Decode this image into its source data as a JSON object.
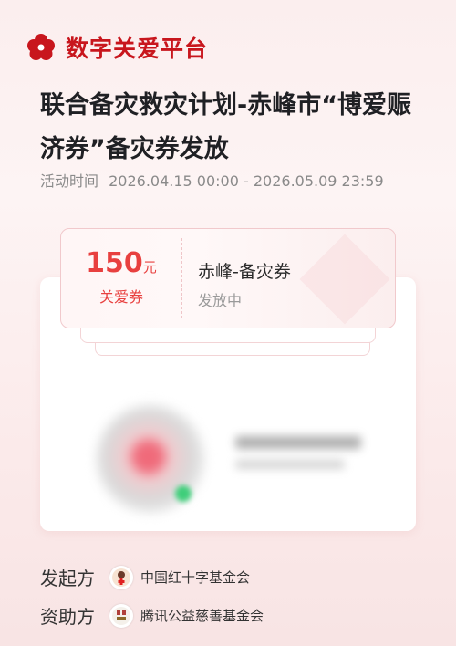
{
  "brand": {
    "name": "数字关爱平台",
    "logo_icon": "red-flower-icon",
    "color": "#c8161d"
  },
  "title": "联合备灾救灾计划-赤峰市“博爱赈济券”备灾券发放",
  "activity": {
    "label": "活动时间",
    "range": "2026.04.15 00:00 - 2026.05.09 23:59"
  },
  "coupon": {
    "amount": "150",
    "unit": "元",
    "type": "关爱券",
    "name": "赤峰-备灾券",
    "status": "发放中",
    "accent": "#e8403f"
  },
  "organizers": [
    {
      "label": "发起方",
      "name": "中国红十字基金会",
      "logo_icon": "red-cross-foundation-logo"
    },
    {
      "label": "资助方",
      "name": "腾讯公益慈善基金会",
      "logo_icon": "tencent-charity-logo"
    }
  ]
}
